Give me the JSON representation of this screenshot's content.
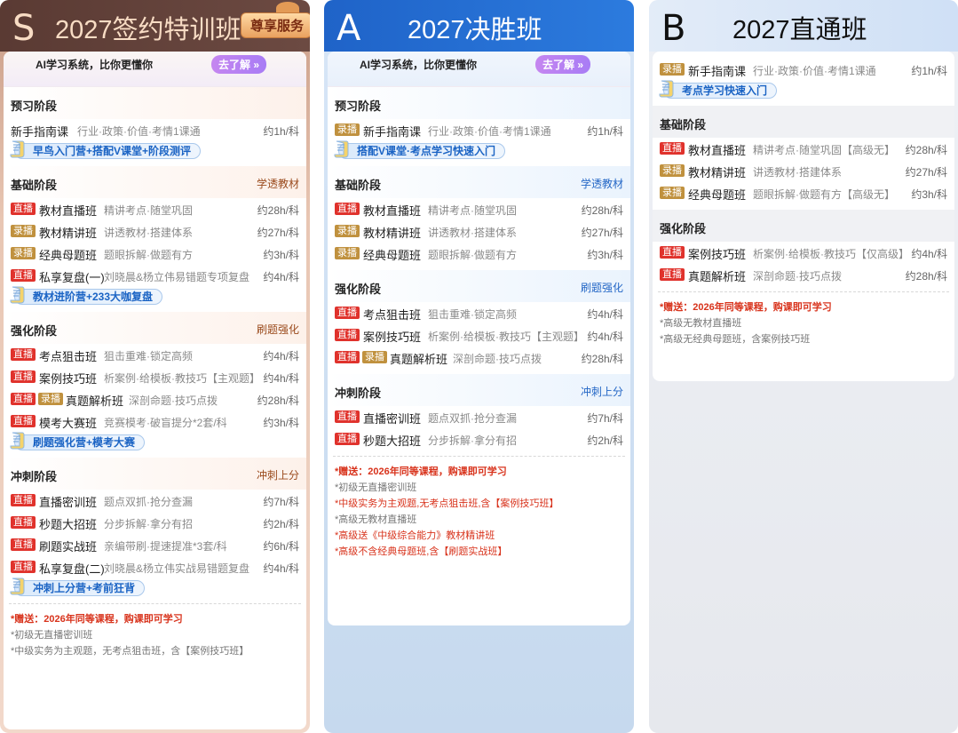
{
  "s": {
    "letter": "S",
    "title": "2027签约特训班",
    "badge": "尊享服务",
    "ai_text": "AI学习系统，比你更懂你",
    "ai_btn": "去了解 »",
    "stages": [
      {
        "name": "预习阶段",
        "tag": "",
        "rows": [
          {
            "tags": [],
            "name": "新手指南课",
            "desc": "行业·政策·价值·考情1课通",
            "hrs": "约1h/科"
          }
        ],
        "promo": "早鸟入门营+搭配V课堂+阶段测评"
      },
      {
        "name": "基础阶段",
        "tag": "学透教材",
        "rows": [
          {
            "tags": [
              "直播"
            ],
            "name": "教材直播班",
            "desc": "精讲考点·随堂巩固",
            "hrs": "约28h/科"
          },
          {
            "tags": [
              "录播"
            ],
            "name": "教材精讲班",
            "desc": "讲透教材·搭建体系",
            "hrs": "约27h/科"
          },
          {
            "tags": [
              "录播"
            ],
            "name": "经典母题班",
            "desc": "题眼拆解·做题有方",
            "hrs": "约3h/科"
          },
          {
            "tags": [
              "直播"
            ],
            "name": "私享复盘(一)",
            "desc": "刘晓晨&杨立伟易错题专项复盘",
            "hrs": "约4h/科"
          }
        ],
        "promo": "教材进阶营+233大咖复盘"
      },
      {
        "name": "强化阶段",
        "tag": "刷题强化",
        "rows": [
          {
            "tags": [
              "直播"
            ],
            "name": "考点狙击班",
            "desc": "狙击重难·锁定高频",
            "hrs": "约4h/科"
          },
          {
            "tags": [
              "直播"
            ],
            "name": "案例技巧班",
            "desc": "析案例·给模板·教技巧【主观题】",
            "hrs": "约4h/科"
          },
          {
            "tags": [
              "直播",
              "录播"
            ],
            "name": "真题解析班",
            "desc": "深剖命题·技巧点拨",
            "hrs": "约28h/科"
          },
          {
            "tags": [
              "直播"
            ],
            "name": "模考大赛班",
            "desc": "竞赛模考·破盲提分*2套/科",
            "hrs": "约3h/科"
          }
        ],
        "promo": "刷题强化营+模考大赛"
      },
      {
        "name": "冲刺阶段",
        "tag": "冲刺上分",
        "rows": [
          {
            "tags": [
              "直播"
            ],
            "name": "直播密训班",
            "desc": "题点双抓·抢分查漏",
            "hrs": "约7h/科"
          },
          {
            "tags": [
              "直播"
            ],
            "name": "秒题大招班",
            "desc": "分步拆解·拿分有招",
            "hrs": "约2h/科"
          },
          {
            "tags": [
              "直播"
            ],
            "name": "刷题实战班",
            "desc": "亲编带刷·提速提准*3套/科",
            "hrs": "约6h/科"
          },
          {
            "tags": [
              "直播"
            ],
            "name": "私享复盘(二)",
            "desc": "刘晓晨&杨立伟实战易错题复盘",
            "hrs": "约4h/科"
          }
        ],
        "promo": "冲刺上分营+考前狂背"
      }
    ],
    "gift": "*赠送：2026年同等课程，购课即可学习",
    "notes": [
      {
        "text": "*初级无直播密训班",
        "red": false
      },
      {
        "text": "*中级实务为主观题，无考点狙击班，含【案例技巧班】",
        "red": false
      }
    ]
  },
  "a": {
    "letter": "A",
    "title": "2027决胜班",
    "ai_text": "AI学习系统，比你更懂你",
    "ai_btn": "去了解 »",
    "stages": [
      {
        "name": "预习阶段",
        "tag": "",
        "rows": [
          {
            "tags": [
              "录播"
            ],
            "name": "新手指南课",
            "desc": "行业·政策·价值·考情1课通",
            "hrs": "约1h/科"
          }
        ],
        "promo": "搭配V课堂·考点学习快速入门"
      },
      {
        "name": "基础阶段",
        "tag": "学透教材",
        "rows": [
          {
            "tags": [
              "直播"
            ],
            "name": "教材直播班",
            "desc": "精讲考点·随堂巩固",
            "hrs": "约28h/科"
          },
          {
            "tags": [
              "录播"
            ],
            "name": "教材精讲班",
            "desc": "讲透教材·搭建体系",
            "hrs": "约27h/科"
          },
          {
            "tags": [
              "录播"
            ],
            "name": "经典母题班",
            "desc": "题眼拆解·做题有方",
            "hrs": "约3h/科"
          }
        ],
        "promo": ""
      },
      {
        "name": "强化阶段",
        "tag": "刷题强化",
        "rows": [
          {
            "tags": [
              "直播"
            ],
            "name": "考点狙击班",
            "desc": "狙击重难·锁定高频",
            "hrs": "约4h/科"
          },
          {
            "tags": [
              "直播"
            ],
            "name": "案例技巧班",
            "desc": "析案例·给模板·教技巧【主观题】",
            "hrs": "约4h/科"
          },
          {
            "tags": [
              "直播",
              "录播"
            ],
            "name": "真题解析班",
            "desc": "深剖命题·技巧点拨",
            "hrs": "约28h/科"
          }
        ],
        "promo": ""
      },
      {
        "name": "冲刺阶段",
        "tag": "冲刺上分",
        "rows": [
          {
            "tags": [
              "直播"
            ],
            "name": "直播密训班",
            "desc": "题点双抓·抢分查漏",
            "hrs": "约7h/科"
          },
          {
            "tags": [
              "直播"
            ],
            "name": "秒题大招班",
            "desc": "分步拆解·拿分有招",
            "hrs": "约2h/科"
          }
        ],
        "promo": ""
      }
    ],
    "gift": "*赠送：2026年同等课程，购课即可学习",
    "notes": [
      {
        "text": "*初级无直播密训班",
        "red": false
      },
      {
        "text": "*中级实务为主观题,无考点狙击班,含【案例技巧班】",
        "red": true
      },
      {
        "text": "*高级无教材直播班",
        "red": false
      },
      {
        "text": "*高级送《中级综合能力》教材精讲班",
        "red": true
      },
      {
        "text": "*高级不含经典母题班,含【刷题实战班】",
        "red": true
      }
    ]
  },
  "b": {
    "letter": "B",
    "title": "2027直通班",
    "stages": [
      {
        "name": "",
        "tag": "",
        "rows": [
          {
            "tags": [
              "录播"
            ],
            "name": "新手指南课",
            "desc": "行业·政策·价值·考情1课通",
            "hrs": "约1h/科"
          }
        ],
        "promo": "考点学习快速入门"
      },
      {
        "name": "基础阶段",
        "tag": "",
        "rows": [
          {
            "tags": [
              "直播"
            ],
            "name": "教材直播班",
            "desc": "精讲考点·随堂巩固【高级无】",
            "hrs": "约28h/科"
          },
          {
            "tags": [
              "录播"
            ],
            "name": "教材精讲班",
            "desc": "讲透教材·搭建体系",
            "hrs": "约27h/科"
          },
          {
            "tags": [
              "录播"
            ],
            "name": "经典母题班",
            "desc": "题眼拆解·做题有方【高级无】",
            "hrs": "约3h/科"
          }
        ],
        "promo": ""
      },
      {
        "name": "强化阶段",
        "tag": "",
        "rows": [
          {
            "tags": [
              "直播"
            ],
            "name": "案例技巧班",
            "desc": "析案例·给模板·教技巧【仅高级】",
            "hrs": "约4h/科"
          },
          {
            "tags": [
              "直播"
            ],
            "name": "真题解析班",
            "desc": "深剖命题·技巧点拨",
            "hrs": "约28h/科"
          }
        ],
        "promo": ""
      }
    ],
    "gift": "*赠送：2026年同等课程，购课即可学习",
    "notes": [
      {
        "text": "*高级无教材直播班",
        "red": false
      },
      {
        "text": "*高级无经典母题班，含案例技巧班",
        "red": false
      }
    ]
  },
  "colors": {
    "live": "#e0322c",
    "recorded": "#c0913e",
    "promo_text": "#1a63c4",
    "gift": "#d8331c"
  }
}
